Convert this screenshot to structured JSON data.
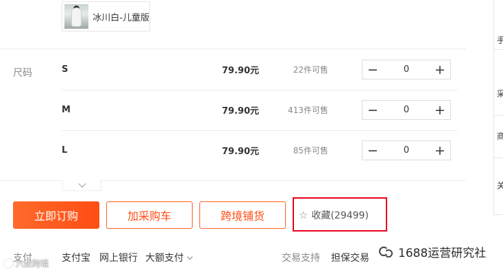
{
  "variant": {
    "label": "冰川白-儿童版"
  },
  "size_label": "尺码",
  "sku_rows": [
    {
      "size": "S",
      "price": "79.90元",
      "stock": "22件可售",
      "qty": "0"
    },
    {
      "size": "M",
      "price": "79.90元",
      "stock": "413件可售",
      "qty": "0"
    },
    {
      "size": "L",
      "price": "79.90元",
      "stock": "85件可售",
      "qty": "0"
    }
  ],
  "stepper": {
    "minus": "−",
    "plus": "+"
  },
  "actions": {
    "buy_now": "立即订购",
    "add_cart": "加采购车",
    "cross_border": "跨境铺货",
    "favorite": "收藏(29499)"
  },
  "payment": {
    "label": "支付",
    "options": [
      "支付宝",
      "网上银行",
      "大额支付"
    ]
  },
  "trade": {
    "label": "交易支持",
    "option": "担保交易"
  },
  "side_panel": {
    "glyphs": [
      "手",
      "采",
      "商",
      "关"
    ]
  },
  "watermark": {
    "right": "1688运营研究社",
    "left": "六数跨境"
  },
  "colors": {
    "accent": "#ff5a1e",
    "highlight_box": "#e8001a"
  },
  "icons": {
    "favorite": "star-outline-icon",
    "expand": "chevron-down-icon"
  }
}
